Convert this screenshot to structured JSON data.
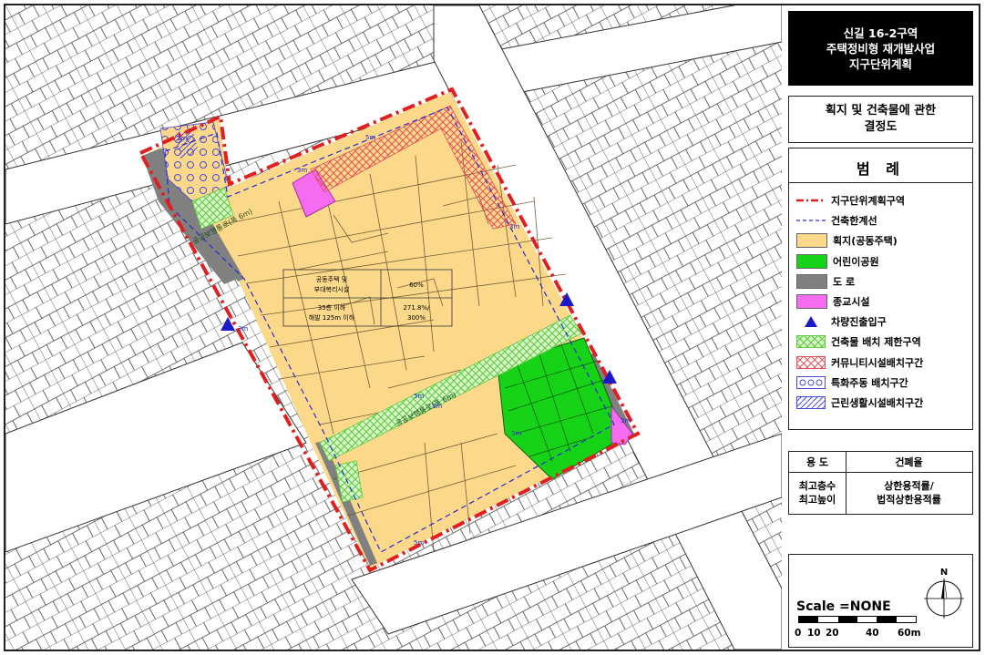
{
  "title": {
    "line1": "신길 16-2구역",
    "line2": "주택정비형 재개발사업",
    "line3": "지구단위계획"
  },
  "subtitle": {
    "line1": "획지 및 건축물에 관한",
    "line2": "결정도"
  },
  "legend": {
    "heading": "범 례",
    "items": [
      {
        "label": "지구단위계획구역",
        "symbol": "dash-dot-red-line",
        "color": "#e02020"
      },
      {
        "label": "건축한계선",
        "symbol": "dashed-blue-line",
        "color": "#2a2ad0"
      },
      {
        "label": "획지(공동주택)",
        "symbol": "fill",
        "color": "#fcd98a"
      },
      {
        "label": "어린이공원",
        "symbol": "fill",
        "color": "#17d317"
      },
      {
        "label": "도 로",
        "symbol": "fill",
        "color": "#808080"
      },
      {
        "label": "종교시설",
        "symbol": "fill",
        "color": "#f56cf0"
      },
      {
        "label": "차량진출입구",
        "symbol": "triangle",
        "color": "#1a1ac8"
      },
      {
        "label": "건축물 배치 제한구역",
        "symbol": "green-crosshatch",
        "color": "#5ccb3c"
      },
      {
        "label": "커뮤니티시설배치구간",
        "symbol": "red-crosshatch",
        "color": "#e0505a"
      },
      {
        "label": "특화주동 배치구간",
        "symbol": "circles",
        "color": "#4a4ad8"
      },
      {
        "label": "근린생활시설배치구간",
        "symbol": "diagonal-hatch",
        "color": "#4a4ad8"
      }
    ]
  },
  "use_table": {
    "header_left": "용 도",
    "header_right": "건폐율",
    "left_line1": "최고층수",
    "left_line2": "최고높이",
    "right_line1": "상한용적률/",
    "right_line2": "법적상한용적률"
  },
  "scale": {
    "text": "Scale =NONE",
    "labels": [
      "0",
      "10",
      "20",
      "40",
      "60m"
    ],
    "compass_label": "N"
  },
  "map": {
    "lot_table": {
      "r1c1_line1": "공동주택 및",
      "r1c1_line2": "부대복리시설",
      "r1c2": "60%",
      "r2c1_line1": "35층 이하",
      "r2c1_line2": "해발 125m 이하",
      "r2c2_line1": "271.8%/",
      "r2c2_line2": "300%"
    },
    "road_label_1": "공공보행통로(폭 6m)",
    "road_label_2": "공공보행통로(폭 6m)",
    "setback_labels": [
      "3m",
      "5m",
      "3m",
      "3m",
      "5m",
      "3m",
      "3m",
      "5m",
      "3m",
      "3m"
    ]
  }
}
